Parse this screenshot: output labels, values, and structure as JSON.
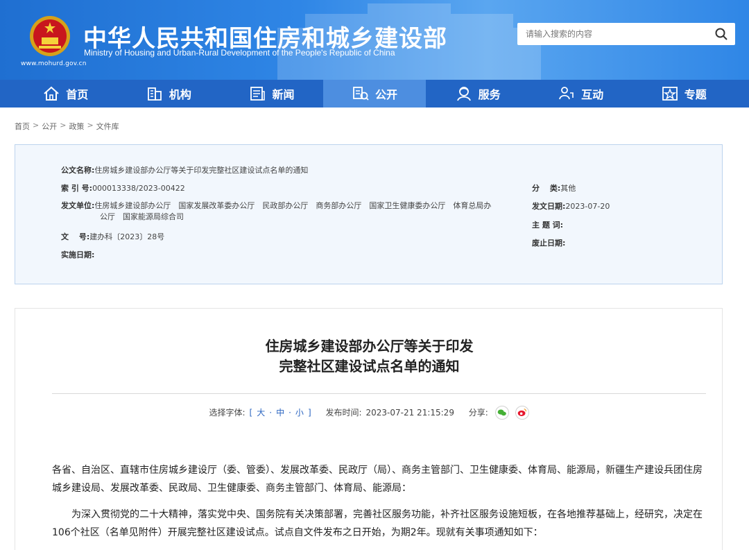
{
  "header": {
    "title_cn": "中华人民共和国住房和城乡建设部",
    "title_en": "Ministry of Housing and Urban-Rural Development of the People's Republic of China",
    "url": "www.mohurd.gov.cn",
    "search_placeholder": "请输入搜索的内容"
  },
  "nav": {
    "items": [
      {
        "label": "首页",
        "icon": "home-icon"
      },
      {
        "label": "机构",
        "icon": "building-icon"
      },
      {
        "label": "新闻",
        "icon": "news-icon"
      },
      {
        "label": "公开",
        "icon": "disclosure-icon"
      },
      {
        "label": "服务",
        "icon": "service-icon"
      },
      {
        "label": "互动",
        "icon": "interact-icon"
      },
      {
        "label": "专题",
        "icon": "star-icon"
      }
    ],
    "active": "公开"
  },
  "breadcrumb": [
    "首页",
    "公开",
    "政策",
    "文件库"
  ],
  "info": {
    "name_label": "公文名称:",
    "name_value": "住房城乡建设部办公厅等关于印发完整社区建设试点名单的通知",
    "index_label": "索 引 号:",
    "index_value": "000013338/2023-00422",
    "category_label": "分　 类:",
    "category_value": "其他",
    "issuer_label": "发文单位:",
    "issuer_line1": "住房城乡建设部办公厅　国家发展改革委办公厅　民政部办公厅　商务部办公厅　国家卫生健康委办公厅　体育总局办",
    "issuer_line2": "公厅　国家能源局综合司",
    "date_label": "发文日期:",
    "date_value": "2023-07-20",
    "doc_label": "文　 号:",
    "doc_value": "建办科〔2023〕28号",
    "subject_label": "主 题 词:",
    "subject_value": "",
    "abolish_label": "废止日期:",
    "abolish_value": "",
    "impl_label": "实施日期:",
    "impl_value": ""
  },
  "article": {
    "title_line1": "住房城乡建设部办公厅等关于印发",
    "title_line2": "完整社区建设试点名单的通知",
    "font_label": "选择字体:",
    "font_open": "[",
    "font_big": "大",
    "font_mid": "中",
    "font_small": "小",
    "font_dot1": "·",
    "font_dot2": "·",
    "font_close": "]",
    "publish_label": "发布时间:",
    "publish_time": "2023-07-21 21:15:29",
    "share_label": "分享:",
    "para1": "各省、自治区、直辖市住房城乡建设厅（委、管委）、发展改革委、民政厅（局）、商务主管部门、卫生健康委、体育局、能源局，新疆生产建设兵团住房城乡建设局、发展改革委、民政局、卫生健康委、商务主管部门、体育局、能源局：",
    "para2": "为深入贯彻党的二十大精神，落实党中央、国务院有关决策部署，完善社区服务功能，补齐社区服务设施短板，在各地推荐基础上，经研究，决定在106个社区（名单见附件）开展完整社区建设试点。试点自文件发布之日开始，为期2年。现就有关事项通知如下："
  },
  "colors": {
    "header_blue": "#1f6fd1",
    "nav_blue": "#2265c5",
    "nav_active": "#4d8ee0",
    "info_bg": "#f2f7fd"
  }
}
